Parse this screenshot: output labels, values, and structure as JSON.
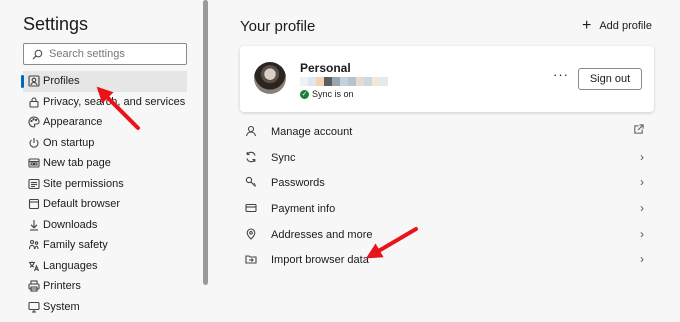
{
  "sidebar": {
    "title": "Settings",
    "search_placeholder": "Search settings",
    "items": [
      {
        "label": "Profiles",
        "icon": "profile-card-icon",
        "active": true
      },
      {
        "label": "Privacy, search, and services",
        "icon": "lock-icon"
      },
      {
        "label": "Appearance",
        "icon": "palette-icon"
      },
      {
        "label": "On startup",
        "icon": "power-icon"
      },
      {
        "label": "New tab page",
        "icon": "new-tab-icon"
      },
      {
        "label": "Site permissions",
        "icon": "site-permissions-icon"
      },
      {
        "label": "Default browser",
        "icon": "default-browser-icon"
      },
      {
        "label": "Downloads",
        "icon": "download-icon"
      },
      {
        "label": "Family safety",
        "icon": "family-icon"
      },
      {
        "label": "Languages",
        "icon": "languages-icon"
      },
      {
        "label": "Printers",
        "icon": "printer-icon"
      },
      {
        "label": "System",
        "icon": "system-icon"
      }
    ]
  },
  "main": {
    "title": "Your profile",
    "add_profile_label": "Add profile",
    "profile": {
      "name": "Personal",
      "sync_status": "Sync is on",
      "more_label": "···",
      "signout_label": "Sign out"
    },
    "rows": [
      {
        "label": "Manage account",
        "icon": "person-icon",
        "trail": "external"
      },
      {
        "label": "Sync",
        "icon": "sync-icon",
        "trail": "chevron"
      },
      {
        "label": "Passwords",
        "icon": "key-icon",
        "trail": "chevron"
      },
      {
        "label": "Payment info",
        "icon": "card-icon",
        "trail": "chevron"
      },
      {
        "label": "Addresses and more",
        "icon": "location-icon",
        "trail": "chevron"
      },
      {
        "label": "Import browser data",
        "icon": "import-icon",
        "trail": "chevron"
      }
    ]
  },
  "colors": {
    "accent": "#0067c0",
    "annotation_arrow": "#e8141a",
    "sync_ok": "#1a7f37"
  }
}
